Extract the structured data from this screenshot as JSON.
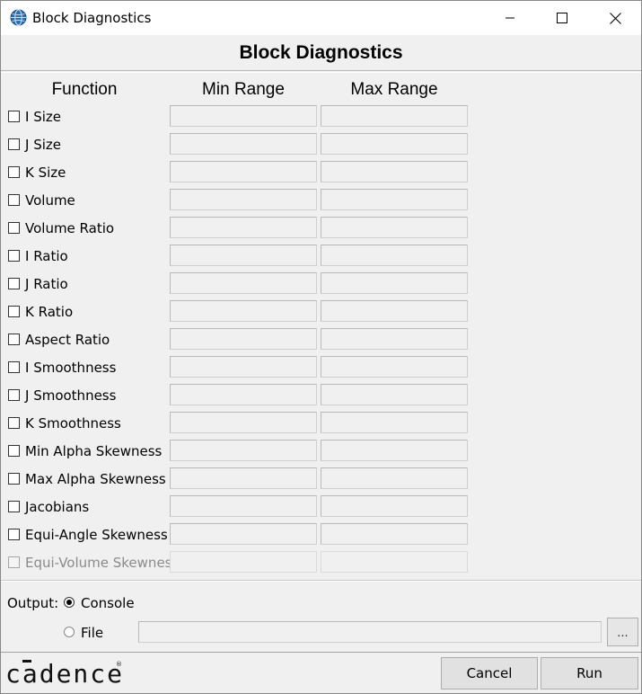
{
  "window": {
    "title": "Block Diagnostics"
  },
  "header": {
    "title": "Block Diagnostics"
  },
  "columns": {
    "function": "Function",
    "min": "Min Range",
    "max": "Max Range"
  },
  "functions": [
    {
      "label": "I Size",
      "checked": false,
      "enabled": true
    },
    {
      "label": "J Size",
      "checked": false,
      "enabled": true
    },
    {
      "label": "K Size",
      "checked": false,
      "enabled": true
    },
    {
      "label": "Volume",
      "checked": false,
      "enabled": true
    },
    {
      "label": "Volume Ratio",
      "checked": false,
      "enabled": true
    },
    {
      "label": "I Ratio",
      "checked": false,
      "enabled": true
    },
    {
      "label": "J Ratio",
      "checked": false,
      "enabled": true
    },
    {
      "label": "K Ratio",
      "checked": false,
      "enabled": true
    },
    {
      "label": "Aspect Ratio",
      "checked": false,
      "enabled": true
    },
    {
      "label": "I Smoothness",
      "checked": false,
      "enabled": true
    },
    {
      "label": "J Smoothness",
      "checked": false,
      "enabled": true
    },
    {
      "label": "K Smoothness",
      "checked": false,
      "enabled": true
    },
    {
      "label": "Min Alpha Skewness",
      "checked": false,
      "enabled": true
    },
    {
      "label": "Max Alpha Skewness",
      "checked": false,
      "enabled": true
    },
    {
      "label": "Jacobians",
      "checked": false,
      "enabled": true
    },
    {
      "label": "Equi-Angle Skewness",
      "checked": false,
      "enabled": true
    },
    {
      "label": "Equi-Volume Skewness",
      "checked": false,
      "enabled": false
    }
  ],
  "output": {
    "label": "Output:",
    "console_label": "Console",
    "file_label": "File",
    "selected": "Console",
    "file_path": "",
    "browse_label": "..."
  },
  "footer": {
    "logo_text": "cadence",
    "cancel_label": "Cancel",
    "run_label": "Run"
  },
  "icons": {
    "app": "globe-icon",
    "minimize": "minimize-icon",
    "maximize": "maximize-icon",
    "close": "close-icon"
  }
}
